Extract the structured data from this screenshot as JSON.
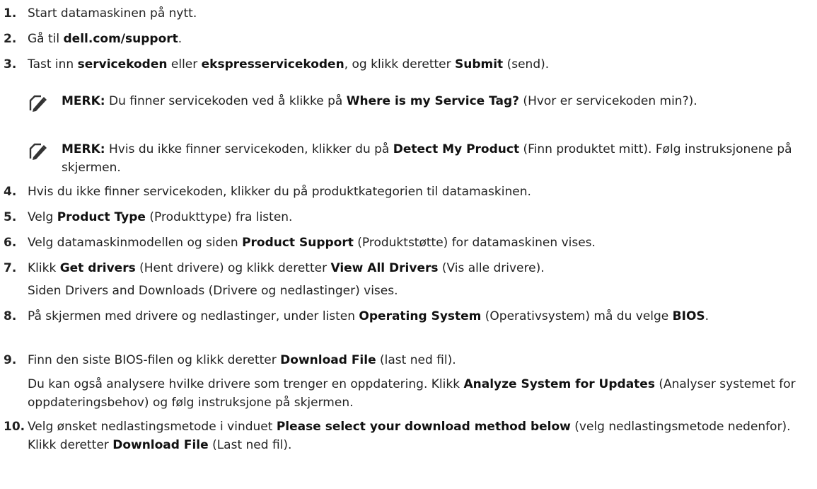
{
  "steps": [
    {
      "num": "1.",
      "parts": [
        {
          "t": "Start datamaskinen på nytt."
        }
      ]
    },
    {
      "num": "2.",
      "parts": [
        {
          "t": "Gå til "
        },
        {
          "t": "dell.com/support",
          "b": true
        },
        {
          "t": "."
        }
      ]
    },
    {
      "num": "3.",
      "parts": [
        {
          "t": "Tast inn "
        },
        {
          "t": "servicekoden",
          "b": true
        },
        {
          "t": " eller "
        },
        {
          "t": "ekspresservicekoden",
          "b": true
        },
        {
          "t": ", og klikk deretter "
        },
        {
          "t": "Submit",
          "b": true
        },
        {
          "t": " (send)."
        }
      ]
    },
    {
      "num": "4.",
      "parts": [
        {
          "t": "Hvis du ikke finner servicekoden, klikker du på produktkategorien til datamaskinen."
        }
      ]
    },
    {
      "num": "5.",
      "parts": [
        {
          "t": "Velg "
        },
        {
          "t": "Product Type",
          "b": true
        },
        {
          "t": " (Produkttype) fra listen."
        }
      ]
    },
    {
      "num": "6.",
      "parts": [
        {
          "t": "Velg datamaskinmodellen og siden "
        },
        {
          "t": "Product Support",
          "b": true
        },
        {
          "t": " (Produktstøtte) for datamaskinen vises."
        }
      ]
    },
    {
      "num": "7.",
      "parts": [
        {
          "t": "Klikk "
        },
        {
          "t": "Get drivers",
          "b": true
        },
        {
          "t": " (Hent drivere) og klikk deretter "
        },
        {
          "t": "View All Drivers",
          "b": true
        },
        {
          "t": " (Vis alle drivere)."
        }
      ]
    },
    {
      "num": "8.",
      "parts": [
        {
          "t": "På skjermen med drivere og nedlastinger, under listen "
        },
        {
          "t": "Operating System",
          "b": true
        },
        {
          "t": " (Operativsystem) må du velge "
        },
        {
          "t": "BIOS",
          "b": true
        },
        {
          "t": "."
        }
      ]
    },
    {
      "num": "9.",
      "parts": [
        {
          "t": "Finn den siste BIOS-filen og klikk deretter "
        },
        {
          "t": "Download File",
          "b": true
        },
        {
          "t": " (last ned fil)."
        }
      ]
    },
    {
      "num": "10.",
      "parts": [
        {
          "t": "Velg ønsket nedlastingsmetode i vinduet "
        },
        {
          "t": "Please select your download method below",
          "b": true
        },
        {
          "t": " (velg nedlastingsmetode nedenfor). Klikk deretter "
        },
        {
          "t": "Download File",
          "b": true
        },
        {
          "t": " (Last ned fil)."
        }
      ]
    }
  ],
  "notes": [
    {
      "parts": [
        {
          "t": "MERK:",
          "b": true
        },
        {
          "t": " Du finner servicekoden ved å klikke på "
        },
        {
          "t": "Where is my Service Tag?",
          "b": true
        },
        {
          "t": " (Hvor er servicekoden min?)."
        }
      ]
    },
    {
      "parts": [
        {
          "t": "MERK:",
          "b": true
        },
        {
          "t": " Hvis du ikke finner servicekoden, klikker du på "
        },
        {
          "t": "Detect My Product",
          "b": true
        },
        {
          "t": " (Finn produktet mitt). Følg instruksjonene på skjermen."
        }
      ]
    }
  ],
  "sublines": {
    "step7": "Siden Drivers and Downloads (Drivere og nedlastinger) vises.",
    "step9": [
      {
        "t": "Du kan også analysere hvilke drivere som trenger en oppdatering. Klikk "
      },
      {
        "t": "Analyze System for Updates",
        "b": true
      },
      {
        "t": " (Analyser systemet for oppdateringsbehov) og følg instruksjone på skjermen."
      }
    ]
  },
  "note_icon": "pencil-note-icon"
}
